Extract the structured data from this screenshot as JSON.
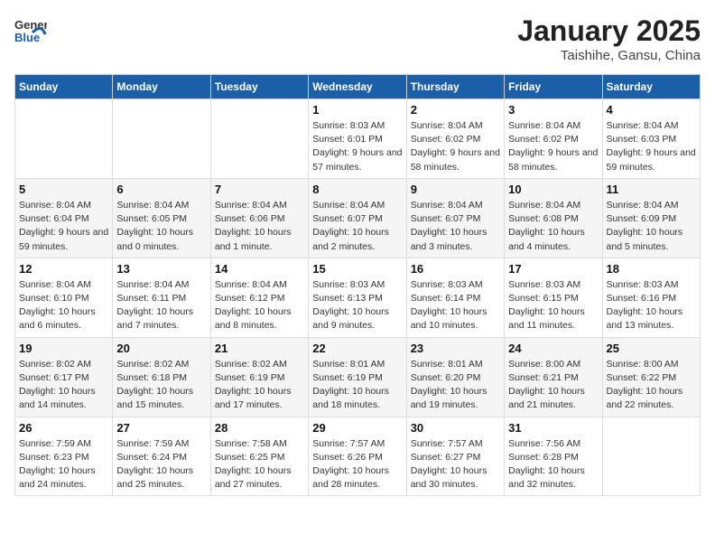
{
  "header": {
    "logo": {
      "general": "General",
      "blue": "Blue"
    },
    "month": "January 2025",
    "location": "Taishihe, Gansu, China"
  },
  "weekdays": [
    "Sunday",
    "Monday",
    "Tuesday",
    "Wednesday",
    "Thursday",
    "Friday",
    "Saturday"
  ],
  "weeks": [
    [
      null,
      null,
      null,
      {
        "day": "1",
        "sunrise": "8:03 AM",
        "sunset": "6:01 PM",
        "daylight": "9 hours and 57 minutes."
      },
      {
        "day": "2",
        "sunrise": "8:04 AM",
        "sunset": "6:02 PM",
        "daylight": "9 hours and 58 minutes."
      },
      {
        "day": "3",
        "sunrise": "8:04 AM",
        "sunset": "6:02 PM",
        "daylight": "9 hours and 58 minutes."
      },
      {
        "day": "4",
        "sunrise": "8:04 AM",
        "sunset": "6:03 PM",
        "daylight": "9 hours and 59 minutes."
      }
    ],
    [
      {
        "day": "5",
        "sunrise": "8:04 AM",
        "sunset": "6:04 PM",
        "daylight": "9 hours and 59 minutes."
      },
      {
        "day": "6",
        "sunrise": "8:04 AM",
        "sunset": "6:05 PM",
        "daylight": "10 hours and 0 minutes."
      },
      {
        "day": "7",
        "sunrise": "8:04 AM",
        "sunset": "6:06 PM",
        "daylight": "10 hours and 1 minute."
      },
      {
        "day": "8",
        "sunrise": "8:04 AM",
        "sunset": "6:07 PM",
        "daylight": "10 hours and 2 minutes."
      },
      {
        "day": "9",
        "sunrise": "8:04 AM",
        "sunset": "6:07 PM",
        "daylight": "10 hours and 3 minutes."
      },
      {
        "day": "10",
        "sunrise": "8:04 AM",
        "sunset": "6:08 PM",
        "daylight": "10 hours and 4 minutes."
      },
      {
        "day": "11",
        "sunrise": "8:04 AM",
        "sunset": "6:09 PM",
        "daylight": "10 hours and 5 minutes."
      }
    ],
    [
      {
        "day": "12",
        "sunrise": "8:04 AM",
        "sunset": "6:10 PM",
        "daylight": "10 hours and 6 minutes."
      },
      {
        "day": "13",
        "sunrise": "8:04 AM",
        "sunset": "6:11 PM",
        "daylight": "10 hours and 7 minutes."
      },
      {
        "day": "14",
        "sunrise": "8:04 AM",
        "sunset": "6:12 PM",
        "daylight": "10 hours and 8 minutes."
      },
      {
        "day": "15",
        "sunrise": "8:03 AM",
        "sunset": "6:13 PM",
        "daylight": "10 hours and 9 minutes."
      },
      {
        "day": "16",
        "sunrise": "8:03 AM",
        "sunset": "6:14 PM",
        "daylight": "10 hours and 10 minutes."
      },
      {
        "day": "17",
        "sunrise": "8:03 AM",
        "sunset": "6:15 PM",
        "daylight": "10 hours and 11 minutes."
      },
      {
        "day": "18",
        "sunrise": "8:03 AM",
        "sunset": "6:16 PM",
        "daylight": "10 hours and 13 minutes."
      }
    ],
    [
      {
        "day": "19",
        "sunrise": "8:02 AM",
        "sunset": "6:17 PM",
        "daylight": "10 hours and 14 minutes."
      },
      {
        "day": "20",
        "sunrise": "8:02 AM",
        "sunset": "6:18 PM",
        "daylight": "10 hours and 15 minutes."
      },
      {
        "day": "21",
        "sunrise": "8:02 AM",
        "sunset": "6:19 PM",
        "daylight": "10 hours and 17 minutes."
      },
      {
        "day": "22",
        "sunrise": "8:01 AM",
        "sunset": "6:19 PM",
        "daylight": "10 hours and 18 minutes."
      },
      {
        "day": "23",
        "sunrise": "8:01 AM",
        "sunset": "6:20 PM",
        "daylight": "10 hours and 19 minutes."
      },
      {
        "day": "24",
        "sunrise": "8:00 AM",
        "sunset": "6:21 PM",
        "daylight": "10 hours and 21 minutes."
      },
      {
        "day": "25",
        "sunrise": "8:00 AM",
        "sunset": "6:22 PM",
        "daylight": "10 hours and 22 minutes."
      }
    ],
    [
      {
        "day": "26",
        "sunrise": "7:59 AM",
        "sunset": "6:23 PM",
        "daylight": "10 hours and 24 minutes."
      },
      {
        "day": "27",
        "sunrise": "7:59 AM",
        "sunset": "6:24 PM",
        "daylight": "10 hours and 25 minutes."
      },
      {
        "day": "28",
        "sunrise": "7:58 AM",
        "sunset": "6:25 PM",
        "daylight": "10 hours and 27 minutes."
      },
      {
        "day": "29",
        "sunrise": "7:57 AM",
        "sunset": "6:26 PM",
        "daylight": "10 hours and 28 minutes."
      },
      {
        "day": "30",
        "sunrise": "7:57 AM",
        "sunset": "6:27 PM",
        "daylight": "10 hours and 30 minutes."
      },
      {
        "day": "31",
        "sunrise": "7:56 AM",
        "sunset": "6:28 PM",
        "daylight": "10 hours and 32 minutes."
      },
      null
    ]
  ]
}
